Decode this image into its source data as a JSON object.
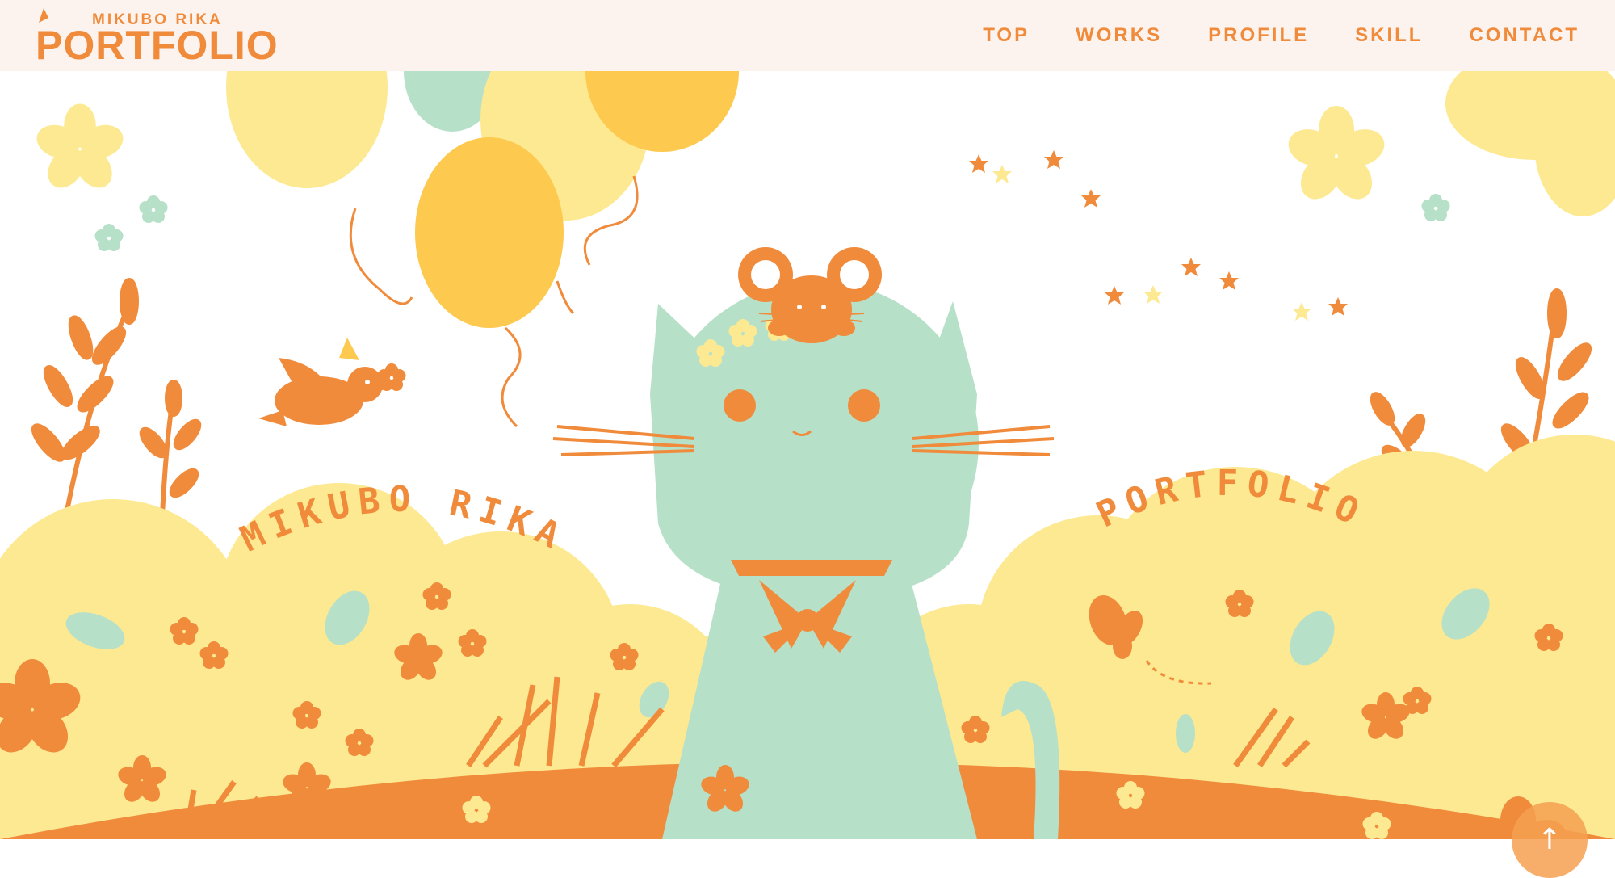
{
  "header": {
    "logo_top": "MIKUBO RIKA",
    "logo_main": "PORTFOLIO",
    "nav": [
      {
        "label": "TOP"
      },
      {
        "label": "WORKS"
      },
      {
        "label": "PROFILE"
      },
      {
        "label": "SKILL"
      },
      {
        "label": "CONTACT"
      }
    ]
  },
  "hero": {
    "left_title": "MIKUBO RIKA",
    "right_title": "PORTFOLIO"
  },
  "scroll_top": {
    "label": "↑"
  },
  "colors": {
    "orange": "#f08b3c",
    "yellow": "#fde991",
    "mint": "#b7e0c8",
    "gold": "#fdc94e",
    "header_bg": "#fdf3ee"
  }
}
